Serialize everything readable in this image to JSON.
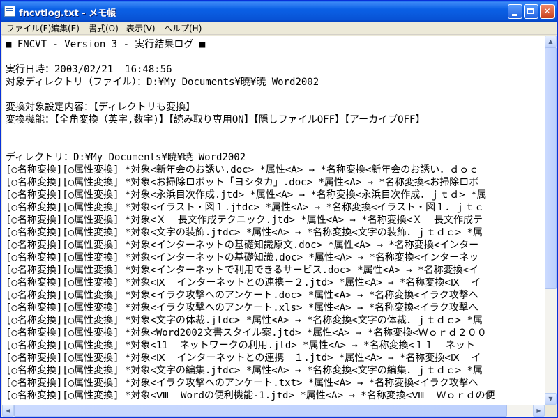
{
  "window": {
    "title": "fncvtlog.txt - メモ帳",
    "buttons": {
      "minimize": "minimize",
      "maximize": "maximize",
      "close": "close"
    }
  },
  "menu": [
    "ファイル(F)",
    "編集(E)",
    "書式(O)",
    "表示(V)",
    "ヘルプ(H)"
  ],
  "content": {
    "lines": [
      "■ FNCVT - Version 3 - 実行結果ログ ■",
      "",
      "実行日時：2003/02/21  16:48:56",
      "対象ディレクトリ（ファイル）：D:¥My Documents¥暁¥暁 Word2002",
      "",
      "変換対象設定内容：【ディレクトリも変換】",
      "変換機能：【全角変換（英字,数字)】【読み取り専用ON】【隠しファイルOFF】【アーカイブOFF】",
      "",
      "",
      "ディレクトリ：D:¥My Documents¥暁¥暁 Word2002",
      "[○名称変換][○属性変換] *対象<新年会のお誘い.doc> *属性<A> → *名称変換<新年会のお誘い．ｄｏｃ",
      "[○名称変換][○属性変換] *対象<お掃除ロボット「ヨシタカ」.doc> *属性<A> → *名称変換<お掃除ロボ",
      "[○名称変換][○属性変換] *対象<永浜目次作成.jtd> *属性<A> → *名称変換<永浜目次作成．ｊｔｄ> *属",
      "[○名称変換][○属性変換] *対象<イラスト・図１.jtdc> *属性<A> → *名称変換<イラスト・図１．ｊｔｃ",
      "[○名称変換][○属性変換] *対象<Ｘ  長文作成テクニック.jtd> *属性<A> → *名称変換<Ｘ  長文作成テ",
      "[○名称変換][○属性変換] *対象<文字の装飾.jtdc> *属性<A> → *名称変換<文字の装飾．ｊｔｄｃ> *属",
      "[○名称変換][○属性変換] *対象<インターネットの基礎知識原文.doc> *属性<A> → *名称変換<インター",
      "[○名称変換][○属性変換] *対象<インターネットの基礎知識.doc> *属性<A> → *名称変換<インターネッ",
      "[○名称変換][○属性変換] *対象<インターネットで利用できるサービス.doc> *属性<A> → *名称変換<イ",
      "[○名称変換][○属性変換] *対象<Ⅸ  インターネットとの連携－２.jtd> *属性<A> → *名称変換<Ⅸ  イ",
      "[○名称変換][○属性変換] *対象<イラク攻撃へのアンケート.doc> *属性<A> → *名称変換<イラク攻撃へ",
      "[○名称変換][○属性変換] *対象<イラク攻撃へのアンケート.xls> *属性<A> → *名称変換<イラク攻撃へ",
      "[○名称変換][○属性変換] *対象<文字の体裁.jtdc> *属性<A> → *名称変換<文字の体裁．ｊｔｄｃ> *属",
      "[○名称変換][○属性変換] *対象<Word2002文書スタイル案.jtd> *属性<A> → *名称変換<Ｗｏｒｄ２００",
      "[○名称変換][○属性変換] *対象<11  ネットワークの利用.jtd> *属性<A> → *名称変換<１１  ネット",
      "[○名称変換][○属性変換] *対象<Ⅸ  インターネットとの連携－１.jtd> *属性<A> → *名称変換<Ⅸ  イ",
      "[○名称変換][○属性変換] *対象<文字の編集.jtdc> *属性<A> → *名称変換<文字の編集．ｊｔｄｃ> *属",
      "[○名称変換][○属性変換] *対象<イラク攻撃へのアンケート.txt> *属性<A> → *名称変換<イラク攻撃へ",
      "[○名称変換][○属性変換] *対象<Ⅷ  Wordの便利機能-1.jtd> *属性<A> → *名称変換<Ⅷ  Ｗｏｒｄの便"
    ]
  },
  "scrollbars": {
    "vertical": {
      "position": 0.0,
      "visible_fraction": 0.7
    },
    "horizontal": {
      "position": 0.0,
      "visible_fraction": 0.95
    }
  }
}
